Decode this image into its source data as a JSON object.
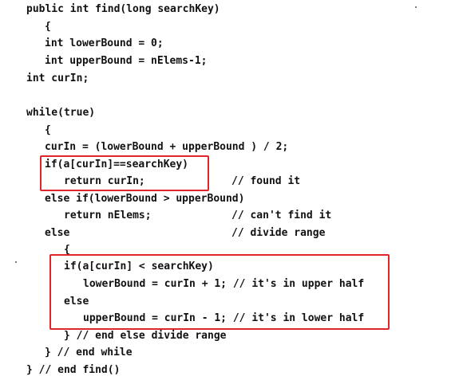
{
  "code_lines": [
    "public int find(long searchKey)",
    "{",
    "int lowerBound = 0;",
    "int upperBound = nElems-1;",
    "int curIn;",
    "while(true)",
    "{",
    "curIn = (lowerBound + upperBound ) / 2;",
    "if(a[curIn]==searchKey)",
    "return curIn;",
    "// found it",
    "else if(lowerBound > upperBound)",
    "return nElems;",
    "// can't find it",
    "else",
    "// divide range",
    "{",
    "if(a[curIn] < searchKey)",
    "lowerBound = curIn + 1; // it's in upper half",
    "else",
    "upperBound = curIn - 1; // it's in lower half",
    "} // end else divide range",
    "} // end while",
    "} // end find()"
  ],
  "colors": {
    "highlight_box": "#e0262b",
    "text": "#111111",
    "background": "#ffffff"
  }
}
